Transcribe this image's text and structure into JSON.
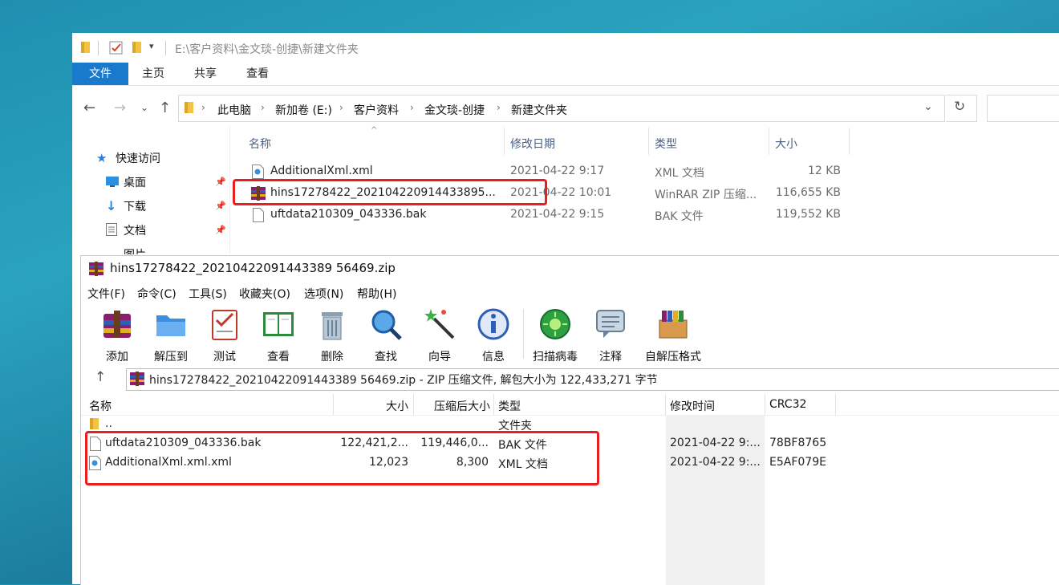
{
  "explorer": {
    "title": "E:\\客户资料\\金文琰-创捷\\新建文件夹",
    "ribbon_tabs": [
      "文件",
      "主页",
      "共享",
      "查看"
    ],
    "breadcrumb": [
      "此电脑",
      "新加卷 (E:)",
      "客户资料",
      "金文琰-创捷",
      "新建文件夹"
    ],
    "nav": {
      "quick_access": "快速访问",
      "items": [
        "桌面",
        "下载",
        "文档",
        "图片"
      ]
    },
    "columns": {
      "name": "名称",
      "date": "修改日期",
      "type": "类型",
      "size": "大小"
    },
    "files": [
      {
        "name": "AdditionalXml.xml",
        "date": "2021-04-22 9:17",
        "type": "XML 文档",
        "size": "12 KB"
      },
      {
        "name": "hins17278422_202104220914433895...",
        "date": "2021-04-22 10:01",
        "type": "WinRAR ZIP 压缩...",
        "size": "116,655 KB"
      },
      {
        "name": "uftdata210309_043336.bak",
        "date": "2021-04-22 9:15",
        "type": "BAK 文件",
        "size": "119,552 KB"
      }
    ]
  },
  "winrar": {
    "title": "hins17278422_20210422091443389 56469.zip",
    "menu": [
      "文件(F)",
      "命令(C)",
      "工具(S)",
      "收藏夹(O)",
      "选项(N)",
      "帮助(H)"
    ],
    "toolbar": [
      "添加",
      "解压到",
      "测试",
      "查看",
      "删除",
      "查找",
      "向导",
      "信息",
      "扫描病毒",
      "注释",
      "自解压格式"
    ],
    "path_text": "hins17278422_20210422091443389 56469.zip - ZIP 压缩文件, 解包大小为 122,433,271 字节",
    "columns": {
      "name": "名称",
      "size": "大小",
      "packed": "压缩后大小",
      "type": "类型",
      "modified": "修改时间",
      "crc": "CRC32"
    },
    "parent_row": {
      "name": "..",
      "type": "文件夹"
    },
    "files": [
      {
        "name": "uftdata210309_043336.bak",
        "size": "122,421,2...",
        "packed": "119,446,0...",
        "type": "BAK 文件",
        "modified": "2021-04-22 9:...",
        "crc": "78BF8765"
      },
      {
        "name": "AdditionalXml.xml.xml",
        "size": "12,023",
        "packed": "8,300",
        "type": "XML 文档",
        "modified": "2021-04-22 9:...",
        "crc": "E5AF079E"
      }
    ]
  },
  "colors": {
    "ribbon_file_tab": "#1979ca",
    "highlight": "#ea1e1e",
    "folder": "#f5c342"
  }
}
